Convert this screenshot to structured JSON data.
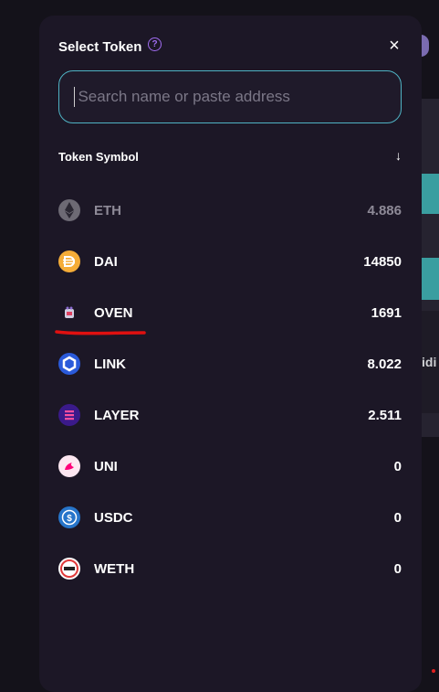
{
  "modal": {
    "title": "Select Token",
    "help_icon": "?",
    "close_icon": "×",
    "search": {
      "placeholder": "Search name or paste address",
      "value": ""
    },
    "list_header": {
      "label": "Token Symbol",
      "sort_icon": "↓"
    },
    "tokens": [
      {
        "symbol": "ETH",
        "balance": "4.886",
        "icon": "ethereum-icon",
        "disabled": true
      },
      {
        "symbol": "DAI",
        "balance": "14850",
        "icon": "dai-icon"
      },
      {
        "symbol": "OVEN",
        "balance": "1691",
        "icon": "oven-icon"
      },
      {
        "symbol": "LINK",
        "balance": "8.022",
        "icon": "chainlink-icon"
      },
      {
        "symbol": "LAYER",
        "balance": "2.511",
        "icon": "layer-icon"
      },
      {
        "symbol": "UNI",
        "balance": "0",
        "icon": "uniswap-icon"
      },
      {
        "symbol": "USDC",
        "balance": "0",
        "icon": "usdc-icon"
      },
      {
        "symbol": "WETH",
        "balance": "0",
        "icon": "weth-icon"
      }
    ]
  },
  "background": {
    "partial_text": "idi"
  },
  "colors": {
    "modal_bg": "#1c1726",
    "accent": "#4fb3c4",
    "help": "#a06cf0",
    "annotation": "#e01010"
  }
}
